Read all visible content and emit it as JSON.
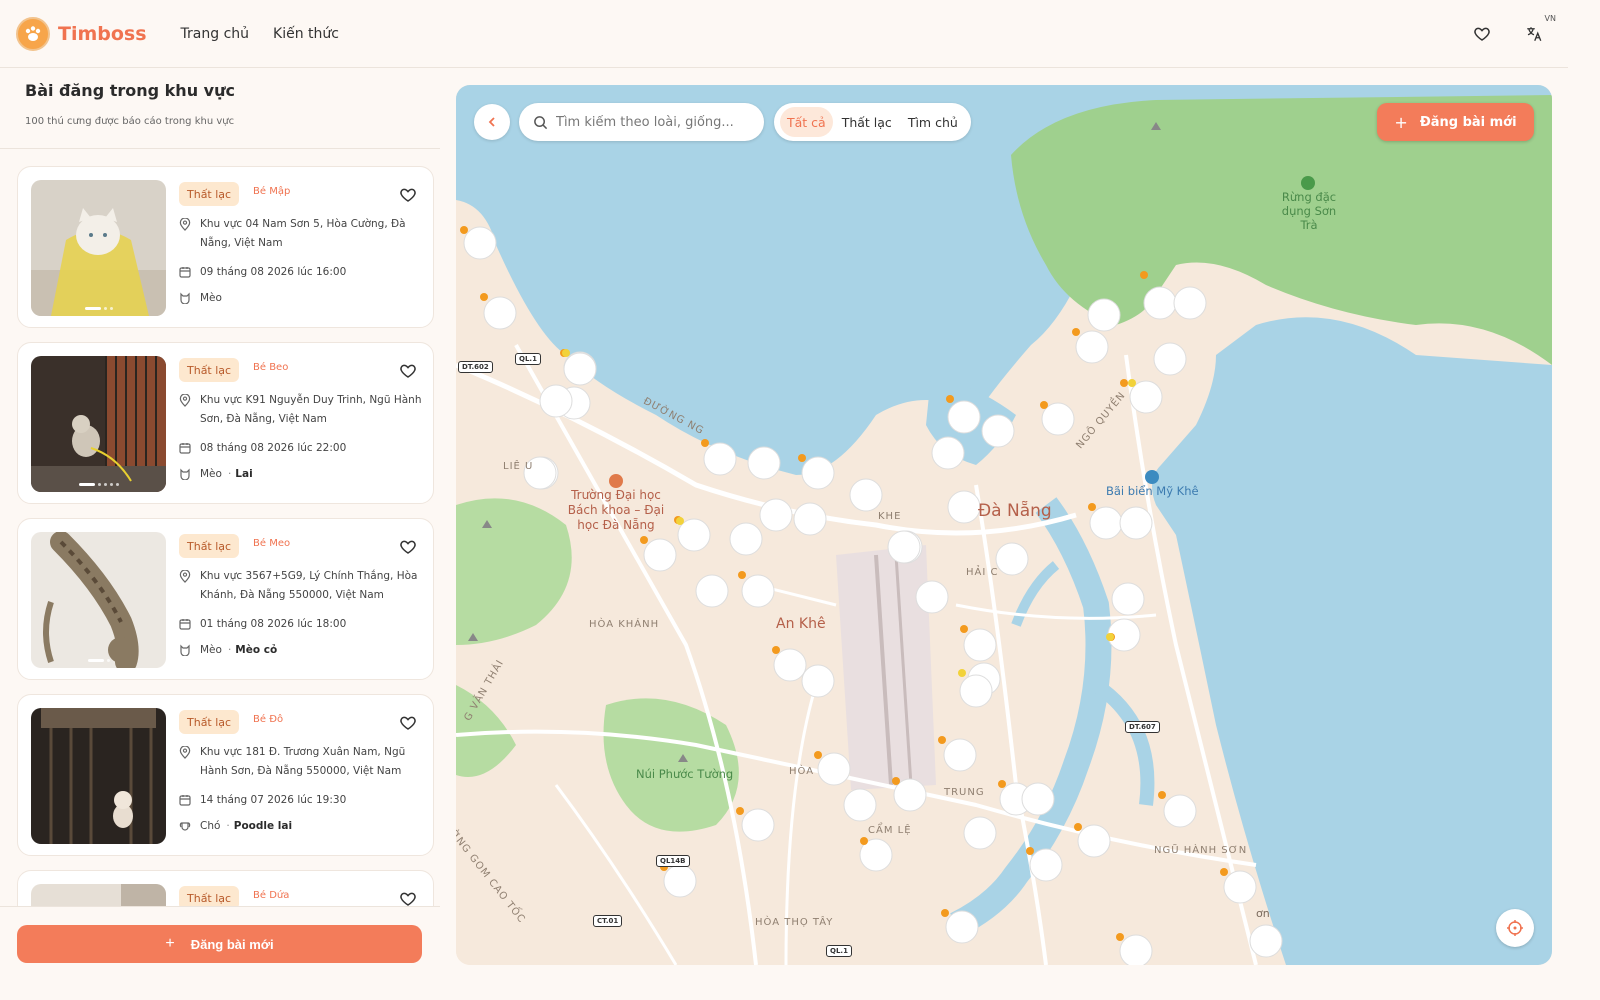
{
  "header": {
    "brand": "Timboss",
    "nav": [
      "Trang chủ",
      "Kiến thức"
    ],
    "lang": "VN"
  },
  "sidebar": {
    "title": "Bài đăng trong khu vực",
    "subtitle": "100 thú cưng được báo cáo trong khu vực",
    "posts": [
      {
        "status": "Thất lạc",
        "name": "Bé Mập",
        "address": "Khu vực 04 Nam Sơn 5, Hòa Cường, Đà Nẵng, Việt Nam",
        "date": "09 tháng 08 2026 lúc 16:00",
        "species": "Mèo",
        "breed": ""
      },
      {
        "status": "Thất lạc",
        "name": "Bé Beo",
        "address": "Khu vực K91 Nguyễn Duy Trinh, Ngũ Hành Sơn, Đà Nẵng, Việt Nam",
        "date": "08 tháng 08 2026 lúc 22:00",
        "species": "Mèo",
        "breed": "Lai"
      },
      {
        "status": "Thất lạc",
        "name": "Bé Meo",
        "address": "Khu vực 3567+5G9, Lý Chính Thắng, Hòa Khánh, Đà Nẵng 550000, Việt Nam",
        "date": "01 tháng 08 2026 lúc 18:00",
        "species": "Mèo",
        "breed": "Mèo cỏ"
      },
      {
        "status": "Thất lạc",
        "name": "Bé Đô",
        "address": "Khu vực 181 Đ. Trương Xuân Nam, Ngũ Hành Sơn, Đà Nẵng 550000, Việt Nam",
        "date": "14 tháng 07 2026 lúc 19:30",
        "species": "Chó",
        "breed": "Poodle lai"
      },
      {
        "status": "Thất lạc",
        "name": "Bé Dứa",
        "address": "",
        "date": "",
        "species": "",
        "breed": ""
      }
    ],
    "post_button": "Đăng bài mới"
  },
  "map": {
    "search_placeholder": "Tìm kiếm theo loài, giống...",
    "filters": [
      "Tất cả",
      "Thất lạc",
      "Tìm chủ"
    ],
    "active_filter": "Tất cả",
    "post_button": "Đăng bài mới",
    "labels": {
      "da_nang": "Đà Nẵng",
      "an_khe": "An Khê",
      "son_tra": "Rừng đặc dụng Sơn Trà",
      "my_khe": "Bãi biển Mỹ Khê",
      "school": "Trường Đại học Bách khoa – Đại học Đà Nẵng",
      "nui_phuoc_tuong": "Núi Phước Tường",
      "hoa_khanh": "HÒA KHÁNH",
      "ngu_hanh_son": "NGŨ HÀNH SƠN",
      "hoa_tho_tay": "HÒA THỌ TÂY",
      "cam_le": "CẨM LỆ",
      "trung": "TRUNG",
      "hai_chau": "HẢI C",
      "khe": "KHE",
      "lieu": "LIÊ     U",
      "hoa": "HÒA",
      "duong_ng": "ĐƯỜNG NG",
      "ngo_quyen": "NGÔ QUYỀN",
      "van_thai": "G VĂN THÁI",
      "gom_cao_toc": "ƯỜNG GOM CAO TỐC",
      "son": "ơn"
    },
    "shields": [
      "DT.602",
      "QL.1",
      "DT.607",
      "CT.01",
      "QL.1",
      "QL14B"
    ]
  },
  "colors": {
    "accent": "#f37c5a",
    "water": "#a9d3e6",
    "park": "#9fd08e",
    "land": "#f6e9dc"
  }
}
